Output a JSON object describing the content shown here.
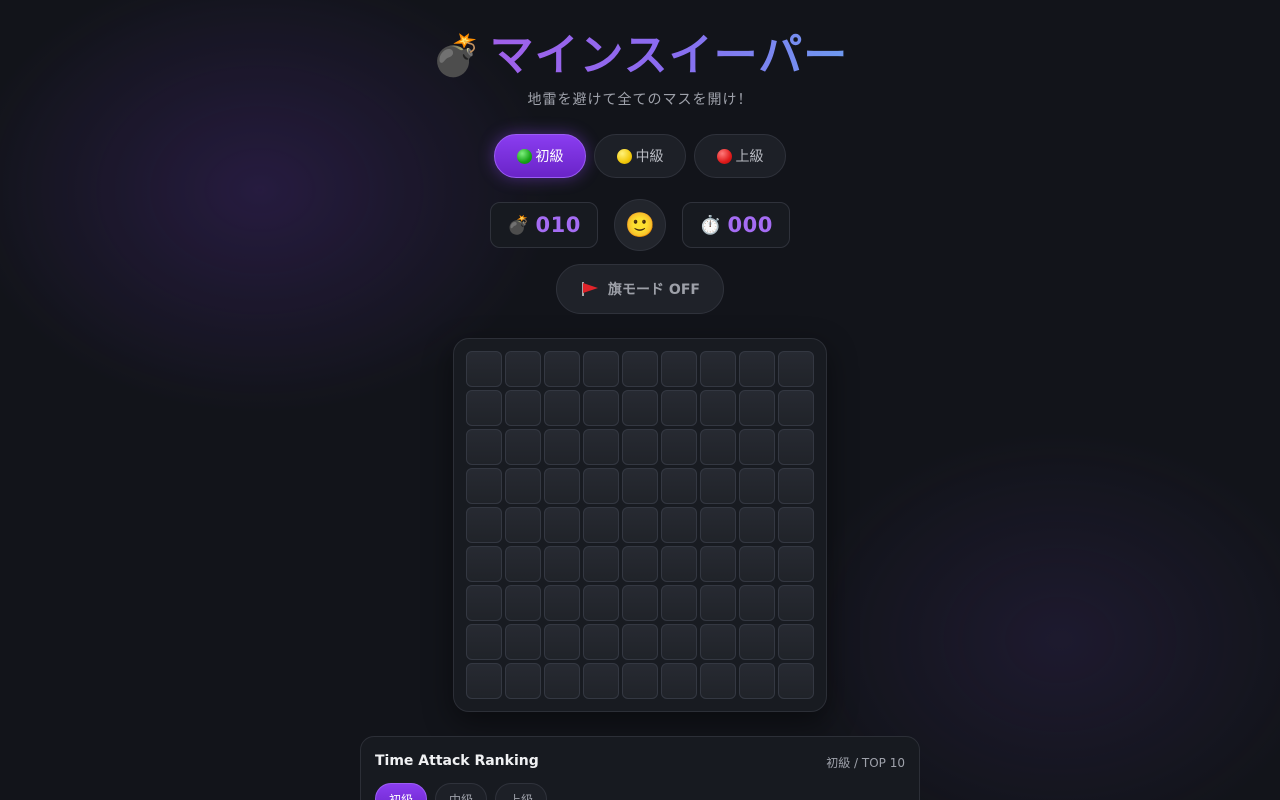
{
  "header": {
    "icon": "bomb-icon",
    "title": "マインスイーパー",
    "subtitle": "地雷を避けて全てのマスを開け！"
  },
  "levels": [
    {
      "label": "初級",
      "dot_color": "#17a317",
      "active": true
    },
    {
      "label": "中級",
      "dot_color": "#f2c90c",
      "active": false
    },
    {
      "label": "上級",
      "dot_color": "#e01b1b",
      "active": false
    }
  ],
  "stats": {
    "mines_icon": "bomb-icon",
    "mines_remaining": "010",
    "face_icon": "slightly-smiling-face-icon",
    "timer_icon": "stopwatch-icon",
    "timer_value": "000"
  },
  "flag_mode": {
    "icon": "red-flag-icon",
    "label": "旗モード OFF"
  },
  "board": {
    "rows": 9,
    "cols": 9,
    "state": "all-unopened"
  },
  "ranking": {
    "title": "Time Attack Ranking",
    "meta": "初級 / TOP 10",
    "tabs": [
      {
        "label": "初級",
        "active": true
      },
      {
        "label": "中級",
        "active": false
      },
      {
        "label": "上級",
        "active": false
      }
    ]
  },
  "colors": {
    "background": "#12141a",
    "accent": "#8a3df0",
    "counter_text": "#a56cf3",
    "title_gradient_start": "#a060ea",
    "title_gradient_end": "#6e9af0"
  }
}
